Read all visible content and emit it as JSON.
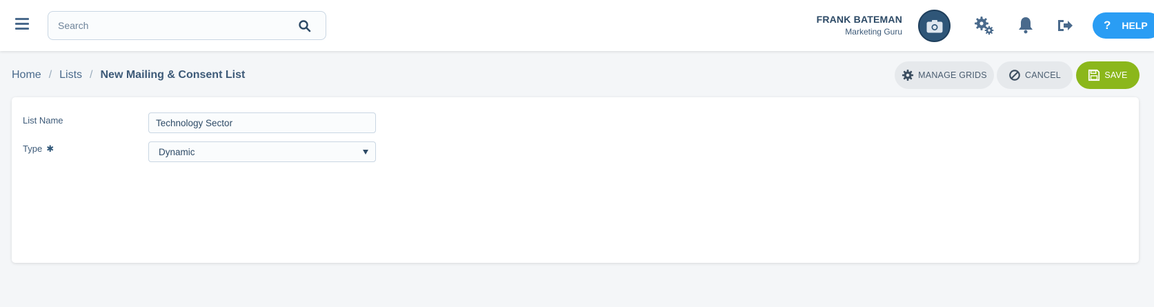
{
  "header": {
    "search_placeholder": "Search",
    "user_name": "FRANK BATEMAN",
    "user_role": "Marketing Guru",
    "help_label": "HELP",
    "help_glyph": "?"
  },
  "icons": {
    "menu": "hamburger-menu-icon",
    "search": "search-icon",
    "avatar": "camera-icon",
    "settings": "gears-icon",
    "notifications": "bell-icon",
    "logout": "sign-out-icon",
    "manage": "gear-icon",
    "cancel": "ban-icon",
    "save": "floppy-disk-icon"
  },
  "breadcrumb": {
    "items": [
      "Home",
      "Lists"
    ],
    "current": "New Mailing & Consent List",
    "separator": "/"
  },
  "actions": {
    "manage_grids": "MANAGE GRIDS",
    "cancel": "CANCEL",
    "save": "SAVE"
  },
  "form": {
    "list_name_label": "List Name",
    "list_name_value": "Technology Sector",
    "type_label": "Type",
    "type_required_marker": "✱",
    "type_value": "Dynamic"
  },
  "colors": {
    "accent_blue": "#2a9df4",
    "save_green": "#8bb71b",
    "text_primary": "#3d5a78"
  }
}
